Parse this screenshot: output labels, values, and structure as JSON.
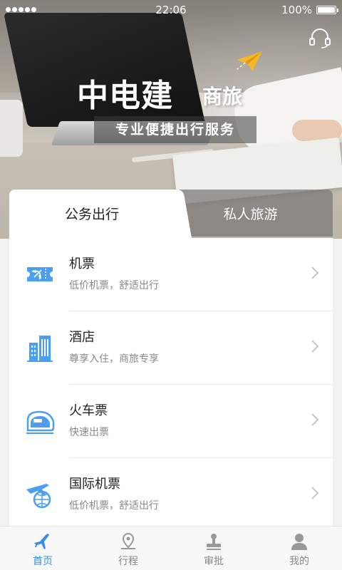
{
  "status_bar": {
    "time": "22:06",
    "battery": "100%"
  },
  "banner": {
    "brand": "中电建",
    "brand_suffix": "商旅",
    "slogan": "专业便捷出行服务"
  },
  "tabs": [
    {
      "label": "公务出行",
      "active": true
    },
    {
      "label": "私人旅游",
      "active": false
    }
  ],
  "services": [
    {
      "icon": "flight-ticket-icon",
      "title": "机票",
      "subtitle": "低价机票，舒适出行"
    },
    {
      "icon": "hotel-icon",
      "title": "酒店",
      "subtitle": "尊享入住，商旅专享"
    },
    {
      "icon": "train-icon",
      "title": "火车票",
      "subtitle": "快速出票"
    },
    {
      "icon": "international-flight-icon",
      "title": "国际机票",
      "subtitle": "低价机票，舒适出行"
    }
  ],
  "bottom_nav": [
    {
      "icon": "plane-icon",
      "label": "首页",
      "active": true
    },
    {
      "icon": "location-pin-icon",
      "label": "行程",
      "active": false
    },
    {
      "icon": "stamp-icon",
      "label": "审批",
      "active": false
    },
    {
      "icon": "person-icon",
      "label": "我的",
      "active": false
    }
  ],
  "colors": {
    "accent": "#3a8ee6",
    "icon_blue": "#4a9ff0",
    "paper_plane": "#f5b72a"
  }
}
